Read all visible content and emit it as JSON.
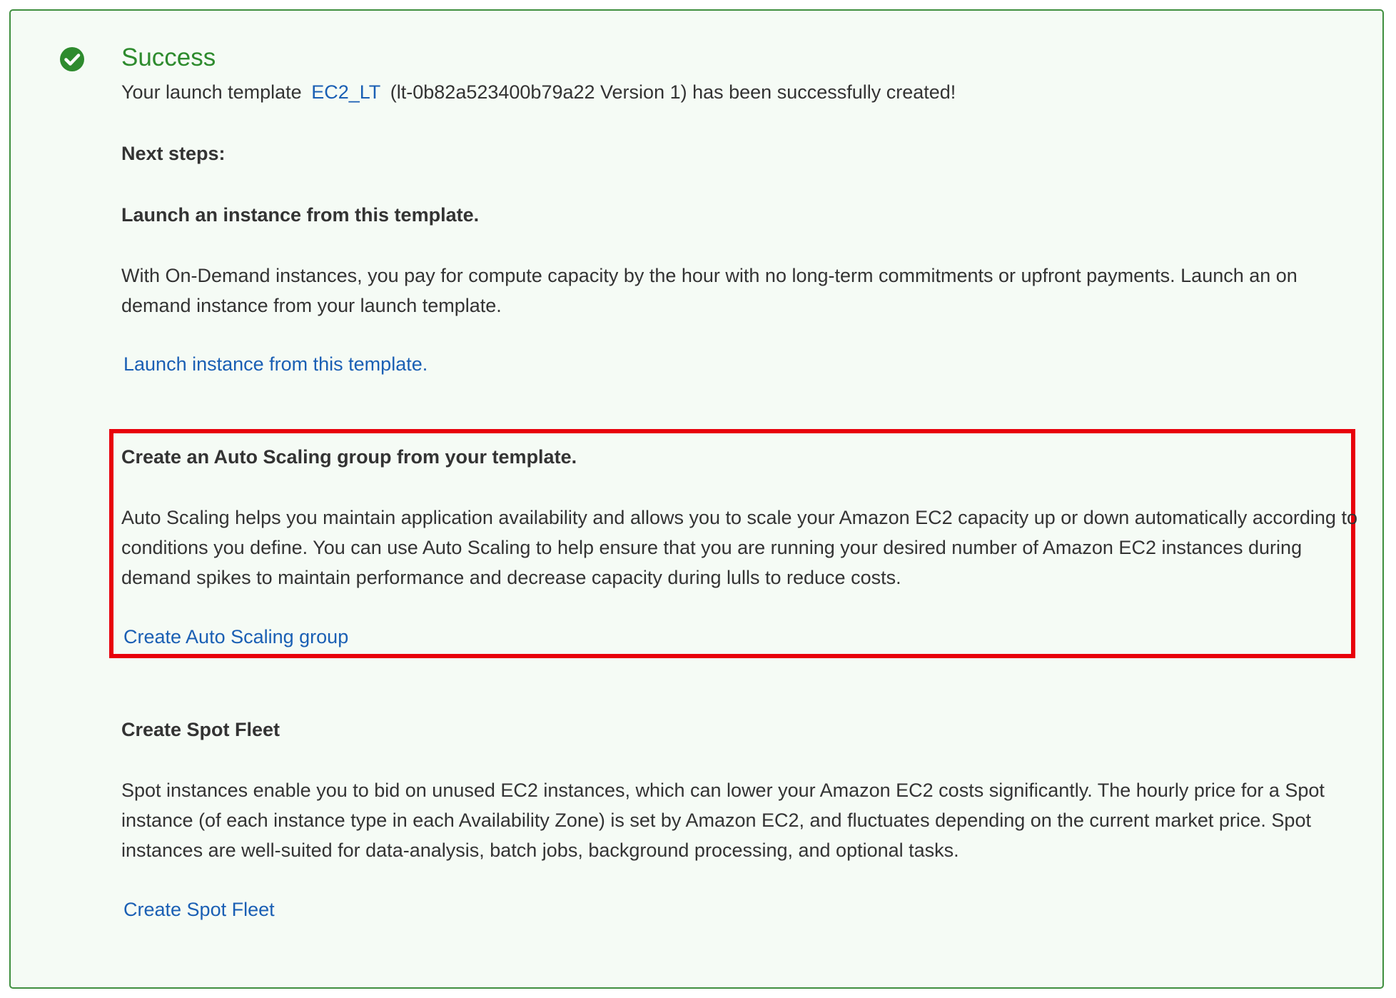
{
  "alert": {
    "status_icon": "check-circle-icon",
    "title": "Success",
    "message_prefix": "Your launch template",
    "template_link": "EC2_LT",
    "message_suffix": "(lt-0b82a523400b79a22 Version 1) has been successfully created!",
    "next_steps_label": "Next steps:",
    "colors": {
      "success_green": "#2e8b2e",
      "border_green": "#3f8f3f",
      "background": "#f5fbf5",
      "link_blue": "#1a5fb4",
      "highlight_red": "#e8000b"
    }
  },
  "sections": {
    "launch_instance": {
      "heading": "Launch an instance from this template.",
      "description": "With On-Demand instances, you pay for compute capacity by the hour with no long-term commitments or upfront payments. Launch an on demand instance from your launch template.",
      "link": "Launch instance from this template."
    },
    "auto_scaling": {
      "heading": "Create an Auto Scaling group from your template.",
      "description": "Auto Scaling helps you maintain application availability and allows you to scale your Amazon EC2 capacity up or down automatically according to conditions you define. You can use Auto Scaling to help ensure that you are running your desired number of Amazon EC2 instances during demand spikes to maintain performance and decrease capacity during lulls to reduce costs.",
      "link": "Create Auto Scaling group"
    },
    "spot_fleet": {
      "heading": "Create Spot Fleet",
      "description": "Spot instances enable you to bid on unused EC2 instances, which can lower your Amazon EC2 costs significantly. The hourly price for a Spot instance (of each instance type in each Availability Zone) is set by Amazon EC2, and fluctuates depending on the current market price. Spot instances are well-suited for data-analysis, batch jobs, background processing, and optional tasks.",
      "link": "Create Spot Fleet"
    }
  }
}
